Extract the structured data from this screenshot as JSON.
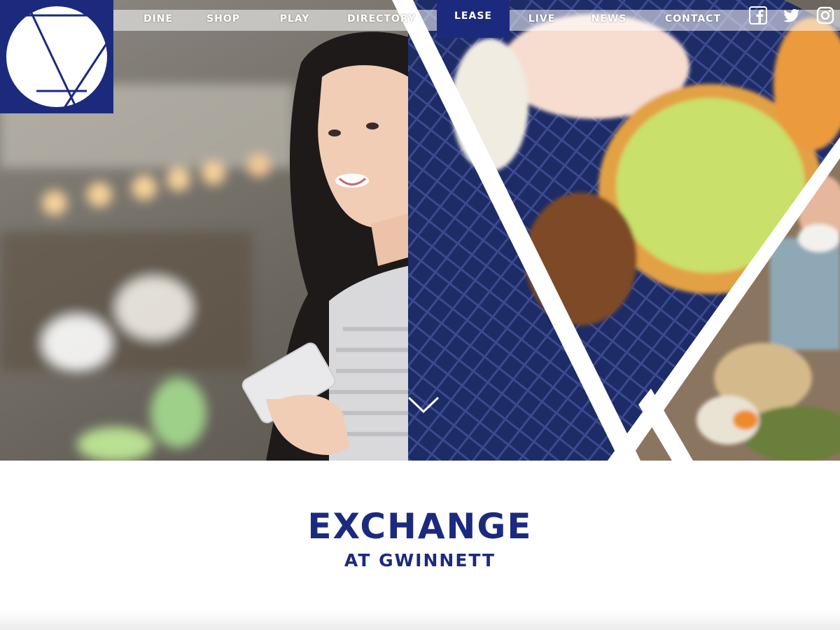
{
  "nav": {
    "items": [
      {
        "label": "DINE"
      },
      {
        "label": "SHOP"
      },
      {
        "label": "PLAY"
      },
      {
        "label": "DIRECTORY"
      },
      {
        "label": "LEASE"
      },
      {
        "label": "LIVE"
      },
      {
        "label": "NEWS"
      },
      {
        "label": "CONTACT"
      }
    ],
    "active": "LEASE",
    "social": [
      "facebook-icon",
      "twitter-icon",
      "instagram-icon"
    ]
  },
  "brand": {
    "title": "EXCHANGE",
    "subtitle": "AT GWINNETT"
  },
  "colors": {
    "brand_blue": "#1c2a7e",
    "white": "#ffffff"
  }
}
